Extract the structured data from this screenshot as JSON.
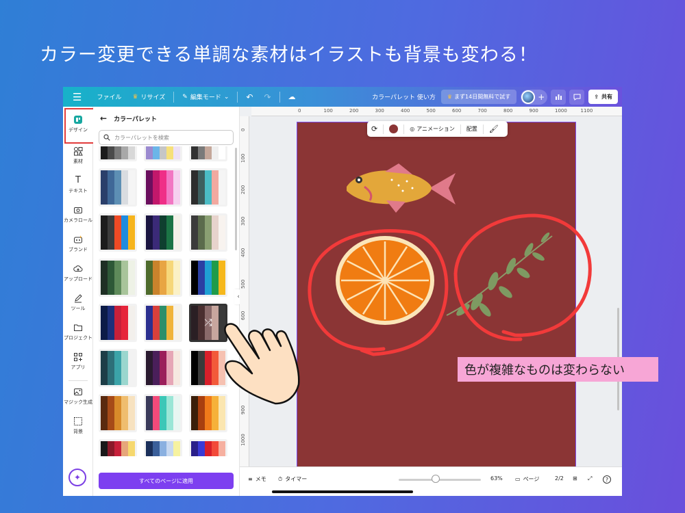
{
  "headline": "カラー変更できる単調な素材はイラストも背景も変わる！",
  "callout": "色が複雑なものは変わらない",
  "topbar": {
    "file": "ファイル",
    "resize": "リサイズ",
    "edit_mode": "編集モード",
    "doc_title": "カラーパレット 使い方",
    "trial": "まず14日間無料で試す",
    "share": "共有"
  },
  "rail": {
    "design": "デザイン",
    "elements": "素材",
    "text": "テキスト",
    "camera_roll": "カメラロール",
    "brand": "ブランド",
    "upload": "アップロード",
    "tools": "ツール",
    "projects": "プロジェクト",
    "apps": "アプリ",
    "magic": "マジック生成",
    "background": "背景"
  },
  "panel": {
    "title": "カラーパレット",
    "search_placeholder": "カラーパレットを検索",
    "apply_all": "すべてのページに適用",
    "palettes": [
      [
        "#1b1b1b",
        "#4a4a4a",
        "#7a7a7a",
        "#a8a8a8",
        "#d8d8d8"
      ],
      [
        "#9b8ad0",
        "#6bb5e8",
        "#c6c6c6",
        "#f6e07a",
        "#ede1f5"
      ],
      [
        "#333333",
        "#7a7a7a",
        "#c4a79a",
        "#efefef",
        "#ffffff"
      ],
      [
        "#2a3f6a",
        "#3f6897",
        "#5d8fb4",
        "#d9dce0",
        "#f5f5f5"
      ],
      [
        "#6b0f5e",
        "#c2186b",
        "#ef2f87",
        "#f277c3",
        "#f6d0ef"
      ],
      [
        "#2d2d2d",
        "#3d5f5f",
        "#4bbcc5",
        "#f2a9a0",
        "#f5f5f5"
      ],
      [
        "#1d1d1d",
        "#3c3c3c",
        "#ef4a25",
        "#1f8be0",
        "#f6b41d"
      ],
      [
        "#1a1440",
        "#3b2a78",
        "#0f3f2f",
        "#1b7445",
        "#f3f1e8"
      ],
      [
        "#3b3b3b",
        "#5b6b4c",
        "#8a9f72",
        "#e7d3cc",
        "#f8f3ef"
      ],
      [
        "#1e2f24",
        "#2d5837",
        "#5e8a5a",
        "#a8c49a",
        "#eef2e6"
      ],
      [
        "#4e6b2c",
        "#c9832c",
        "#e8a543",
        "#f6d77a",
        "#fbf1c6"
      ],
      [
        "#000000",
        "#2b3fa3",
        "#1fa0d4",
        "#1f9b4a",
        "#f6b81c"
      ],
      [
        "#0c1b47",
        "#1d2f7a",
        "#c7203a",
        "#e6253b",
        "#f3f0ec"
      ],
      [
        "#2b2f8f",
        "#d8403b",
        "#2d8f6a",
        "#f0b43a",
        "#f6f2e8"
      ],
      [
        "#2a1f24",
        "#4a2f30",
        "#8a6a6a",
        "#c7a69e",
        "#3a3a3a"
      ],
      [
        "#1d3d47",
        "#2d6f78",
        "#3ba3a8",
        "#9ad6ce",
        "#f2f2f2"
      ],
      [
        "#2a1a2f",
        "#4a1f5a",
        "#9b1f5a",
        "#e6a6b6",
        "#f6e8e0"
      ],
      [
        "#000000",
        "#3a3a3a",
        "#d81f2a",
        "#f25a3a",
        "#f6c1b1"
      ],
      [
        "#5a2a0f",
        "#a64a18",
        "#d88a2a",
        "#efbd6e",
        "#f7e2c0"
      ],
      [
        "#3a3a5a",
        "#f24a7a",
        "#3cc7b7",
        "#9ae6d6",
        "#e8f6f2"
      ],
      [
        "#3a1f0a",
        "#a83f0f",
        "#ef7a1a",
        "#f6b13a",
        "#fbe6b0"
      ],
      [
        "#1a1a1a",
        "#8a1a2a",
        "#c7203a",
        "#e6a67a",
        "#f6d86e"
      ],
      [
        "#1a2f5a",
        "#3a5f9a",
        "#8ab0e0",
        "#c7d8f0",
        "#f6f2a0"
      ],
      [
        "#2a1f8a",
        "#3a3ad6",
        "#d81f2a",
        "#f24a3a",
        "#f6b0a0"
      ]
    ]
  },
  "float_toolbar": {
    "animation": "アニメーション",
    "arrange": "配置"
  },
  "bottombar": {
    "notes": "メモ",
    "timer": "タイマー",
    "zoom": "63%",
    "pages": "ページ",
    "page_count": "2/2",
    "help": "?"
  },
  "ruler_top": [
    "0",
    "100",
    "200",
    "300",
    "400",
    "500",
    "600",
    "700",
    "800",
    "900",
    "1000",
    "1100"
  ],
  "ruler_left": [
    "0",
    "100",
    "200",
    "300",
    "400",
    "500",
    "600",
    "700",
    "800",
    "900",
    "1000"
  ],
  "colors": {
    "artboard": "#8b3535",
    "accent": "#7d3ff0",
    "highlight": "#e23b3b",
    "callout_bg": "#f7a6d6"
  }
}
